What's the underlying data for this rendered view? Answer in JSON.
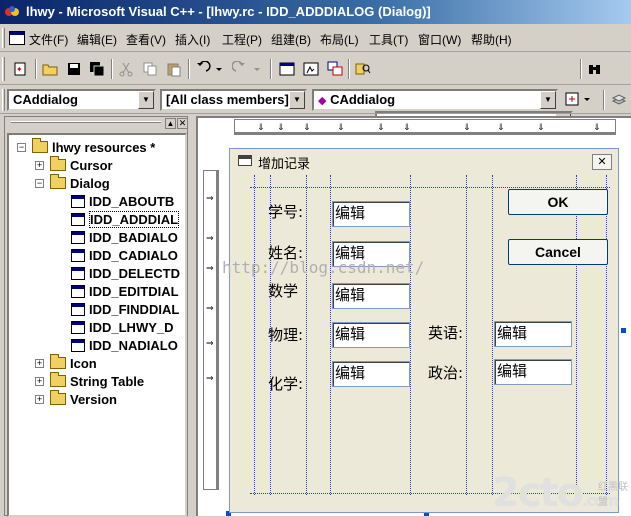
{
  "window": {
    "title": "lhwy - Microsoft Visual C++ - [lhwy.rc - IDD_ADDDIALOG (Dialog)]"
  },
  "menu": [
    "文件(F)",
    "编辑(E)",
    "查看(V)",
    "插入(I)",
    "工程(P)",
    "组建(B)",
    "布局(L)",
    "工具(T)",
    "窗口(W)",
    "帮助(H)"
  ],
  "toolbar2": {
    "class_combo": "CAddialog",
    "filter_combo": "[All class members]",
    "member_combo": "CAddialog"
  },
  "tree": {
    "root": "lhwy resources *",
    "folders": {
      "cursor": "Cursor",
      "dialog": "Dialog",
      "icon": "Icon",
      "string_table": "String Table",
      "version": "Version"
    },
    "dialogs": [
      "IDD_ABOUTB",
      "IDD_ADDDIAL",
      "IDD_BADIALO",
      "IDD_CADIALO",
      "IDD_DELECTD",
      "IDD_EDITDIAL",
      "IDD_FINDDIAL",
      "IDD_LHWY_D",
      "IDD_NADIALO"
    ]
  },
  "dialog": {
    "title": "增加记录",
    "labels": {
      "student_id": "学号:",
      "name": "姓名:",
      "math": "数学",
      "physics": "物理:",
      "chemistry": "化学:",
      "english": "英语:",
      "politics": "政治:"
    },
    "edit_text": "编辑",
    "ok": "OK",
    "cancel": "Cancel"
  },
  "watermark": "http://blog.csdn.net/",
  "logo": {
    "main": "2cto",
    "sub": ".com",
    "cn": "红黑联盟"
  },
  "colors": {
    "title_bar": "#0a246a",
    "guide_lines": "#2040c0",
    "selection": "#0050c8"
  }
}
